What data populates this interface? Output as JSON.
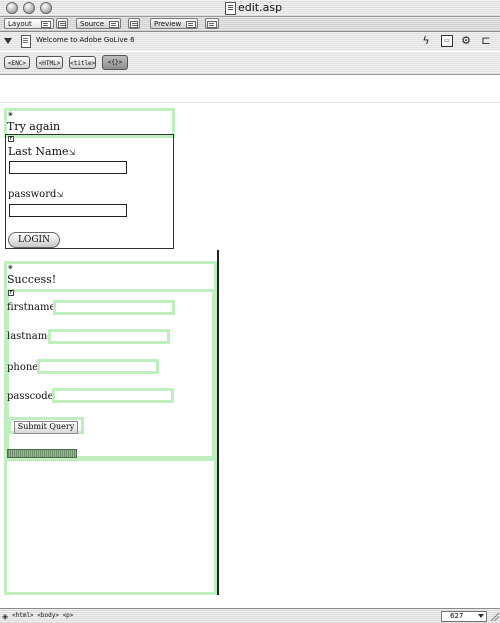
{
  "window": {
    "title": "edit.asp"
  },
  "tabs": [
    {
      "label": "Layout",
      "active": true
    },
    {
      "label": "Source",
      "active": false
    },
    {
      "label": "Preview",
      "active": false
    }
  ],
  "doc_toolbar": {
    "page_title": "Welcome to Adobe GoLive 6",
    "icons": [
      "link-icon",
      "view-icon",
      "server-icon",
      "stack-icon"
    ]
  },
  "tags": {
    "head": "<ENC>",
    "html": "<HTML>",
    "title": "<title>",
    "tag4": "<{}>"
  },
  "form1": {
    "heading": "Try again",
    "lastname_label": "Last Name",
    "password_label": "password",
    "button_label": "LOGIN"
  },
  "form2": {
    "heading": "Success!",
    "fields": [
      {
        "label": "firstname"
      },
      {
        "label": "lastname"
      },
      {
        "label": "phone"
      },
      {
        "label": "passcode"
      }
    ],
    "submit_label": "Submit Query"
  },
  "status": {
    "path": "<html> <body> <p>",
    "width": "627"
  },
  "colors": {
    "frame_green": "#bfeebf",
    "frame_dark": "#333333"
  }
}
